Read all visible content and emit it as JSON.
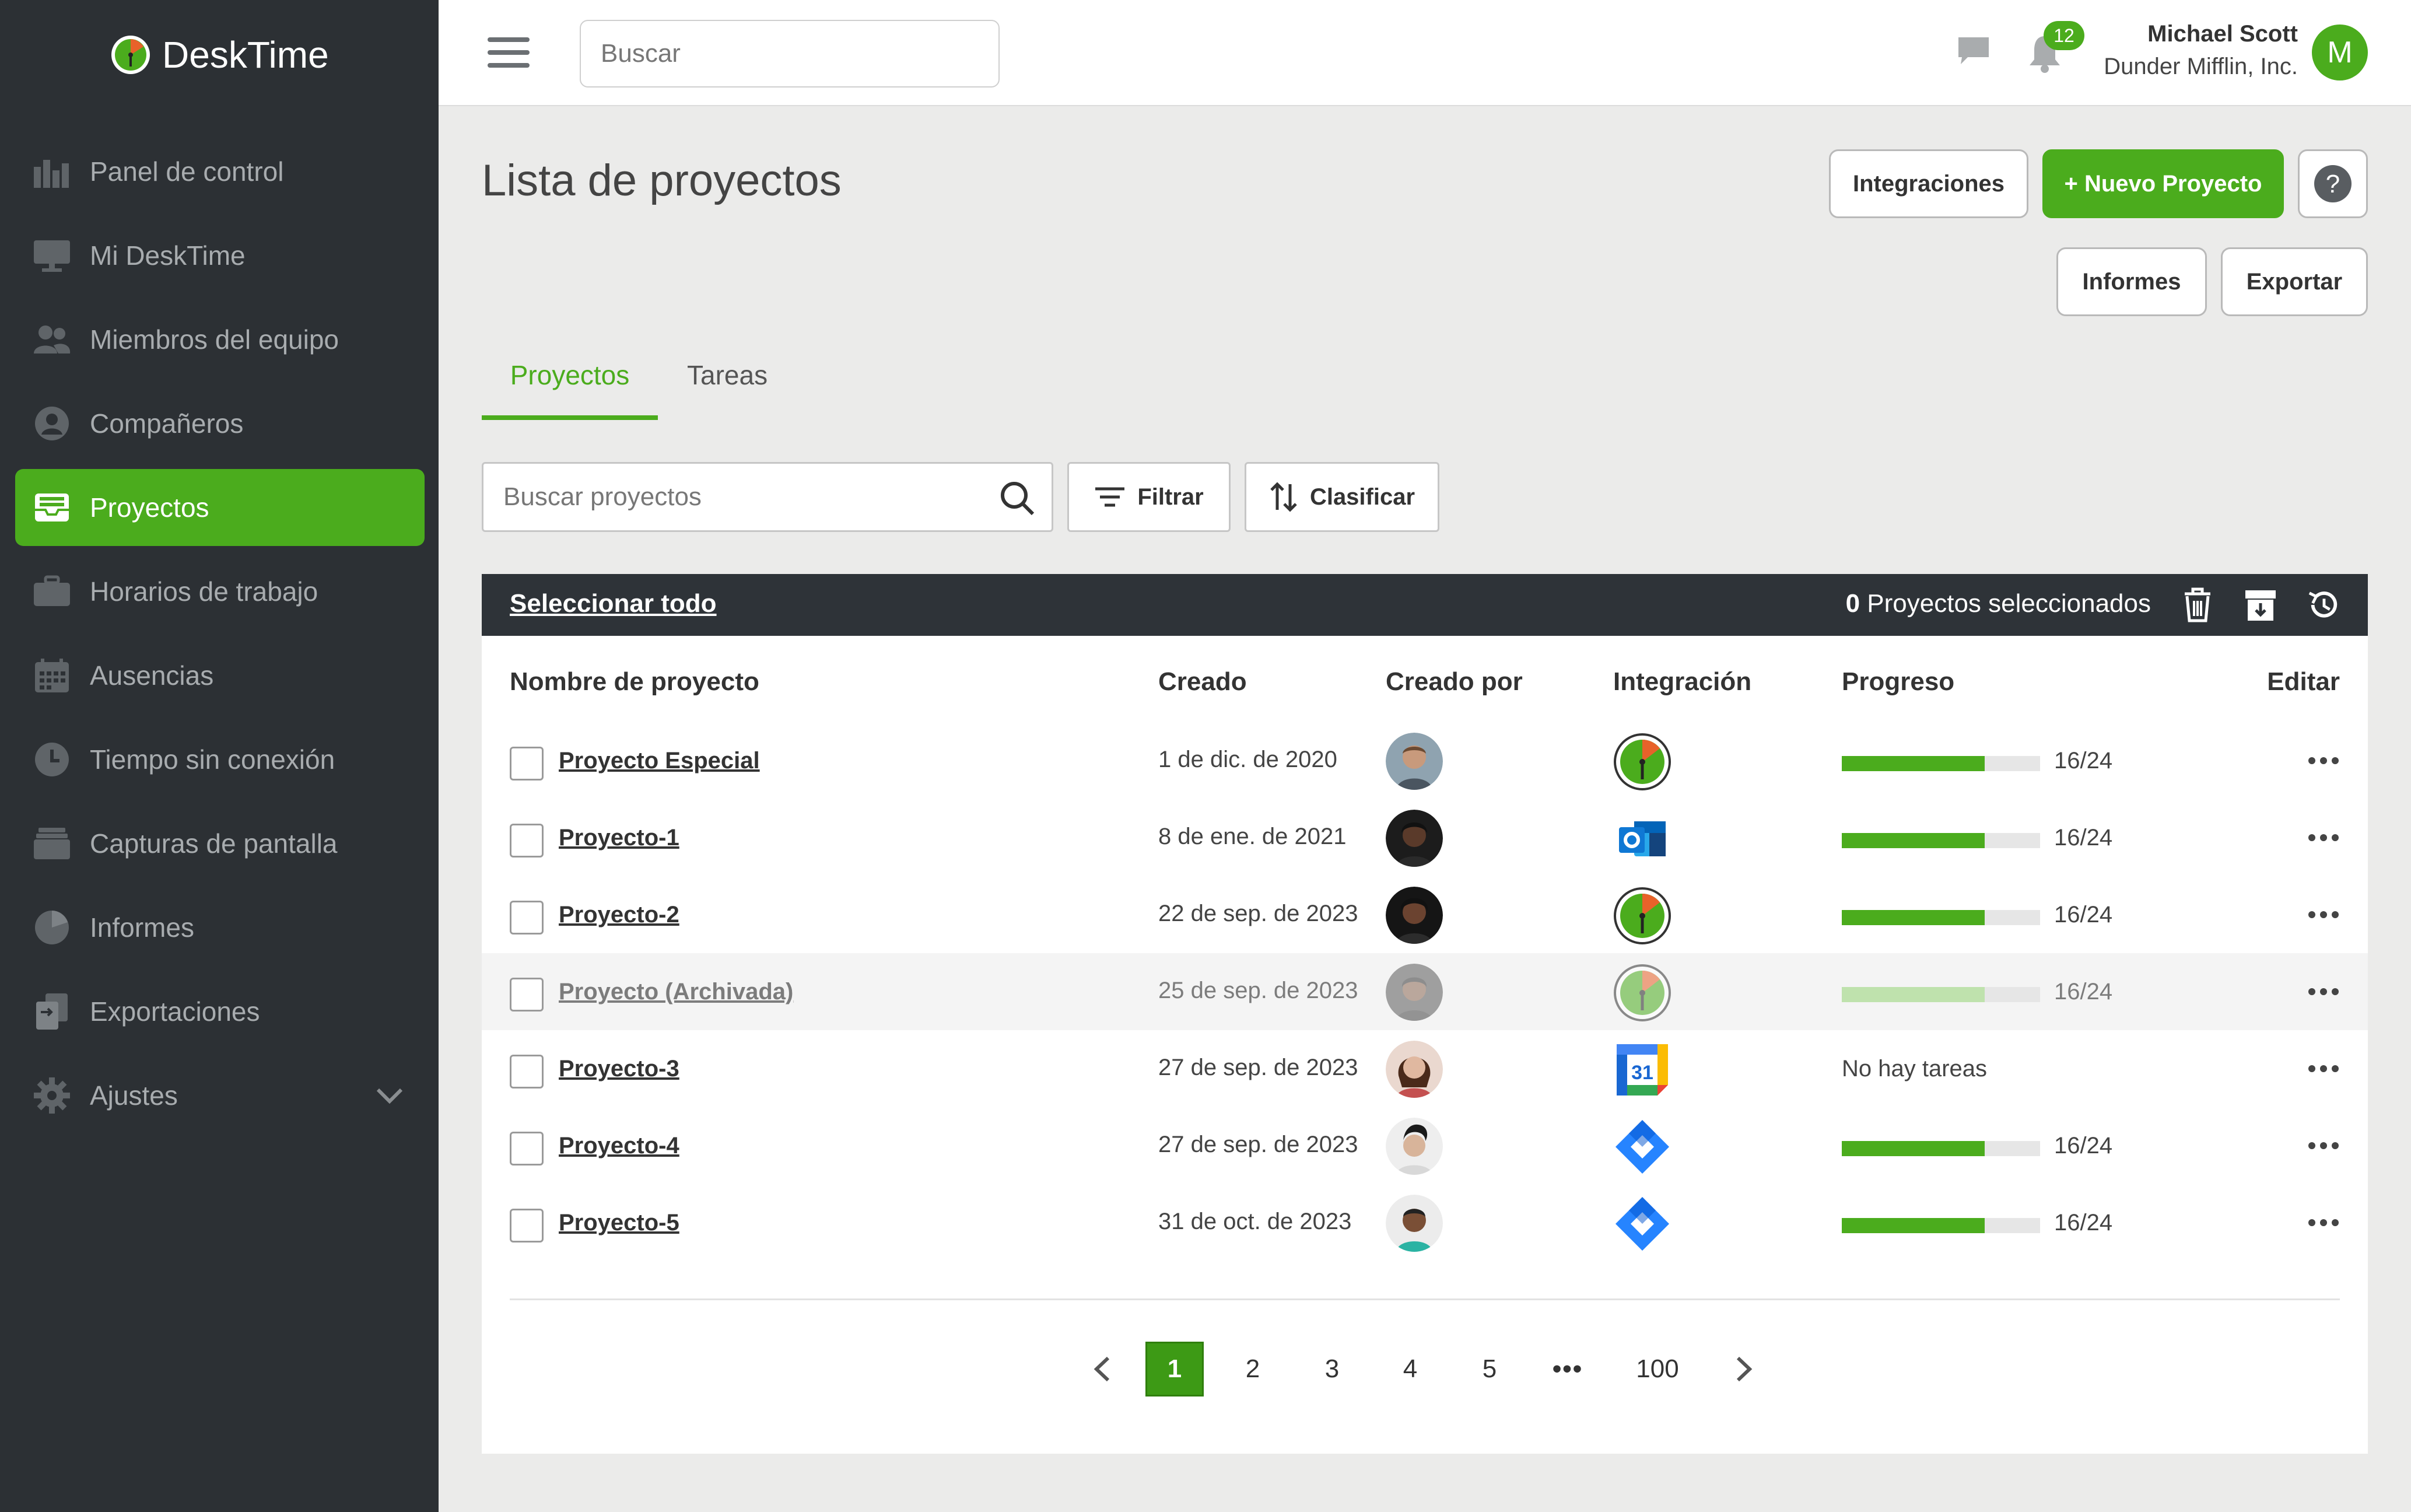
{
  "app": {
    "name": "DeskTime",
    "brand_color": "#4bac1d"
  },
  "sidebar": {
    "items": [
      {
        "label": "Panel de control",
        "icon": "bar-chart-icon"
      },
      {
        "label": "Mi DeskTime",
        "icon": "monitor-icon"
      },
      {
        "label": "Miembros del equipo",
        "icon": "team-icon"
      },
      {
        "label": "Compañeros",
        "icon": "user-circle-icon"
      },
      {
        "label": "Proyectos",
        "icon": "projects-tray-icon",
        "active": true
      },
      {
        "label": "Horarios de trabajo",
        "icon": "briefcase-icon"
      },
      {
        "label": "Ausencias",
        "icon": "calendar-icon"
      },
      {
        "label": "Tiempo sin conexión",
        "icon": "clock-icon"
      },
      {
        "label": "Capturas de pantalla",
        "icon": "screenshots-icon"
      },
      {
        "label": "Informes",
        "icon": "pie-chart-icon"
      },
      {
        "label": "Exportaciones",
        "icon": "export-files-icon"
      },
      {
        "label": "Ajustes",
        "icon": "gear-icon",
        "expandable": true
      }
    ]
  },
  "topbar": {
    "search_placeholder": "Buscar",
    "notification_count": "12",
    "user_name": "Michael Scott",
    "company": "Dunder Mifflin, Inc.",
    "avatar_letter": "M"
  },
  "page": {
    "title": "Lista de proyectos",
    "buttons": {
      "integrations": "Integraciones",
      "new_project": "+ Nuevo Proyecto",
      "reports": "Informes",
      "export": "Exportar"
    },
    "tabs": [
      {
        "label": "Proyectos",
        "active": true
      },
      {
        "label": "Tareas",
        "active": false
      }
    ],
    "search_placeholder": "Buscar proyectos",
    "filter_label": "Filtrar",
    "sort_label": "Clasificar"
  },
  "table": {
    "select_all": "Seleccionar todo",
    "selected_count": "0",
    "selected_label": "Proyectos seleccionados",
    "headers": {
      "name": "Nombre de proyecto",
      "created": "Creado",
      "created_by": "Creado por",
      "integration": "Integración",
      "progress": "Progreso",
      "edit": "Editar"
    },
    "rows": [
      {
        "name": "Proyecto Especial",
        "created": "1 de dic. de 2020",
        "integration": "desktime",
        "progress": "16/24",
        "progress_fraction": 0.667,
        "avatar_skin": "#c89a7c",
        "avatar_hair": "#6b4a32",
        "archived": false
      },
      {
        "name": "Proyecto-1",
        "created": "8 de ene. de 2021",
        "integration": "outlook",
        "progress": "16/24",
        "progress_fraction": 0.667,
        "avatar_skin": "#5a3a2a",
        "avatar_hair": "#111111",
        "archived": false
      },
      {
        "name": "Proyecto-2",
        "created": "22 de sep. de 2023",
        "integration": "desktime",
        "progress": "16/24",
        "progress_fraction": 0.667,
        "avatar_skin": "#6b4330",
        "avatar_hair": "#111111",
        "archived": false
      },
      {
        "name": "Proyecto (Archivada)",
        "created": "25 de sep. de 2023",
        "integration": "desktime",
        "progress": "16/24",
        "progress_fraction": 0.667,
        "avatar_skin": "#8b6a55",
        "avatar_hair": "#3a3a3a",
        "archived": true
      },
      {
        "name": "Proyecto-3",
        "created": "27 de sep. de 2023",
        "integration": "google-calendar",
        "calendar_day": "31",
        "progress": "",
        "no_tasks": "No hay tareas",
        "avatar_skin": "#e0b8a0",
        "avatar_hair": "#4a2a1a",
        "archived": false
      },
      {
        "name": "Proyecto-4",
        "created": "27 de sep. de 2023",
        "integration": "jira",
        "progress": "16/24",
        "progress_fraction": 0.667,
        "avatar_skin": "#d8b49a",
        "avatar_hair": "#1a1a1a",
        "archived": false
      },
      {
        "name": "Proyecto-5",
        "created": "31 de oct. de 2023",
        "integration": "jira",
        "progress": "16/24",
        "progress_fraction": 0.667,
        "avatar_skin": "#7a4f36",
        "avatar_hair": "#222222",
        "archived": false
      }
    ]
  },
  "pagination": {
    "pages": [
      "1",
      "2",
      "3",
      "4",
      "5"
    ],
    "ellipsis": "•••",
    "last": "100",
    "current": "1"
  }
}
